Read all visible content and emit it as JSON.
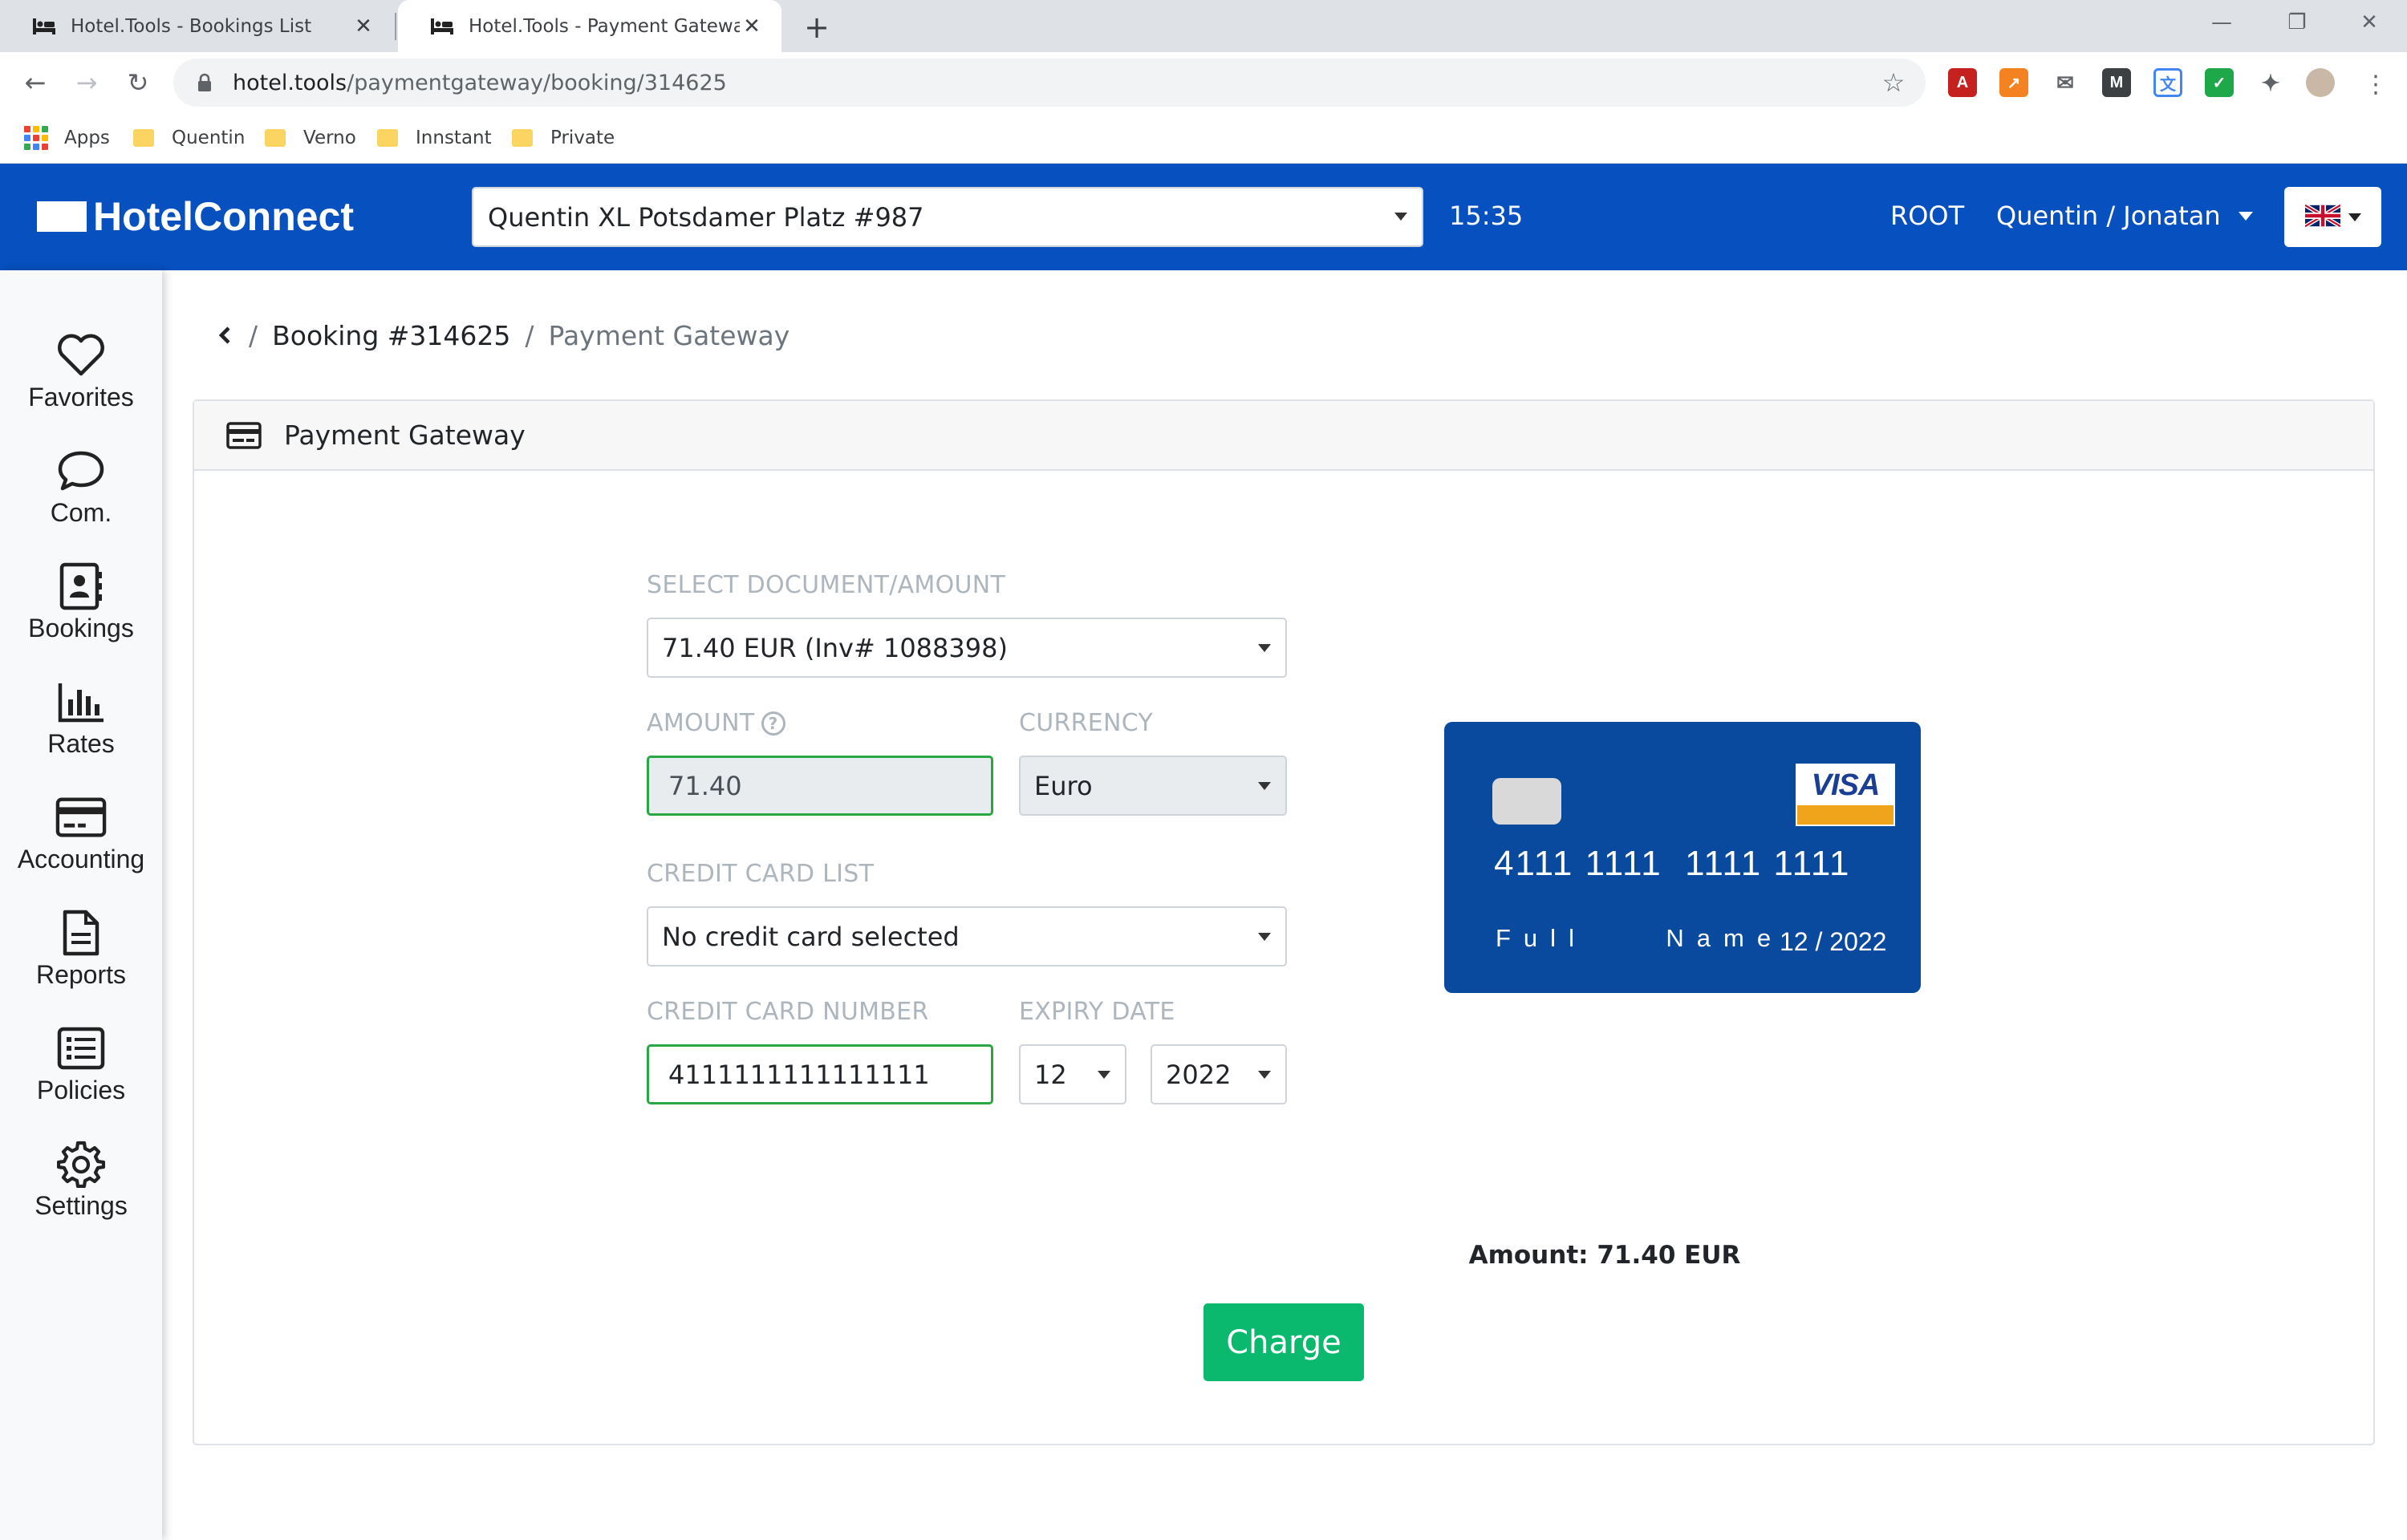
{
  "browser": {
    "tabs": [
      {
        "title": "Hotel.Tools - Bookings List",
        "active": false
      },
      {
        "title": "Hotel.Tools - Payment Gateway",
        "active": true
      }
    ],
    "url_host": "hotel.tools",
    "url_path": "/paymentgateway/booking/314625",
    "bookmarks": [
      {
        "label": "Apps",
        "icon": "apps-grid-icon"
      },
      {
        "label": "Quentin",
        "icon": "folder-icon"
      },
      {
        "label": "Verno",
        "icon": "folder-icon"
      },
      {
        "label": "Innstant",
        "icon": "folder-icon"
      },
      {
        "label": "Private",
        "icon": "folder-icon"
      }
    ]
  },
  "header": {
    "logo_text": "HotelConnect",
    "hotel_select": "Quentin XL Potsdamer Platz #987",
    "time": "15:35",
    "root_label": "ROOT",
    "user_label": "Quentin / Jonatan",
    "language_icon": "uk-flag-icon",
    "brand_color": "#0650c0"
  },
  "sidebar": {
    "items": [
      {
        "label": "Favorites",
        "icon": "heart-icon"
      },
      {
        "label": "Com.",
        "icon": "chat-bubble-icon"
      },
      {
        "label": "Bookings",
        "icon": "address-book-icon"
      },
      {
        "label": "Rates",
        "icon": "bar-chart-icon"
      },
      {
        "label": "Accounting",
        "icon": "credit-card-icon"
      },
      {
        "label": "Reports",
        "icon": "document-icon"
      },
      {
        "label": "Policies",
        "icon": "list-icon"
      },
      {
        "label": "Settings",
        "icon": "gear-icon"
      }
    ]
  },
  "breadcrumb": {
    "back_icon": "chevron-left-icon",
    "separator": "/",
    "booking": "Booking #314625",
    "current": "Payment Gateway"
  },
  "card": {
    "title": "Payment Gateway",
    "icon": "payment-card-icon"
  },
  "form": {
    "document_label": "SELECT DOCUMENT/AMOUNT",
    "document_value": "71.40 EUR (Inv# 1088398)",
    "amount_label": "AMOUNT",
    "amount_help": "?",
    "amount_value": "71.40",
    "currency_label": "CURRENCY",
    "currency_value": "Euro",
    "cc_list_label": "CREDIT CARD LIST",
    "cc_list_value": "No credit card selected",
    "cc_number_label": "CREDIT CARD NUMBER",
    "cc_number_value": "4111111111111111",
    "expiry_label": "EXPIRY DATE",
    "expiry_month": "12",
    "expiry_year": "2022"
  },
  "card_preview": {
    "number": "4111 1111  1111 1111",
    "name": "Full    Name",
    "expiry": "12 / 2022",
    "brand": "VISA",
    "card_color": "#0a4a9e"
  },
  "summary": {
    "amount_text": "Amount: 71.40 EUR",
    "charge_label": "Charge",
    "charge_color": "#0ab96e"
  }
}
